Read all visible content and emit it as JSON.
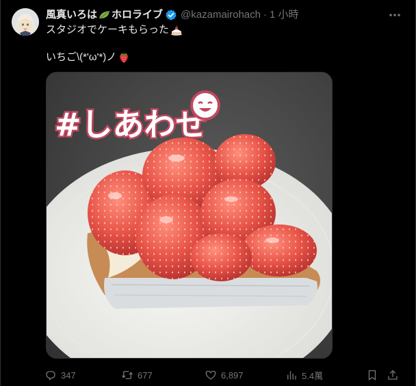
{
  "user": {
    "display_name": "風真いろは",
    "display_name_suffix": "ホロライブ",
    "handle": "@kazamairohach",
    "separator": "·",
    "time": "1 小時"
  },
  "tweet": {
    "line1": "スタジオでケーキもらった",
    "line2": "いちご\\(*'ω'*)ノ"
  },
  "media": {
    "overlay_text": "#しあわせ"
  },
  "actions": {
    "reply_count": "347",
    "retweet_count": "677",
    "like_count": "6,897",
    "view_count": "5.4萬"
  },
  "icons": {
    "leaf": "leaf-icon",
    "verified": "verified-badge-icon",
    "more": "more-dots-icon",
    "reply": "reply-icon",
    "retweet": "retweet-icon",
    "like": "heart-icon",
    "views": "views-chart-icon",
    "bookmark": "bookmark-icon",
    "share": "share-icon"
  },
  "colors": {
    "background": "#000000",
    "text": "#e7e9ea",
    "muted": "#71767b",
    "verified": "#1d9bf0",
    "divider": "#2f3336"
  }
}
